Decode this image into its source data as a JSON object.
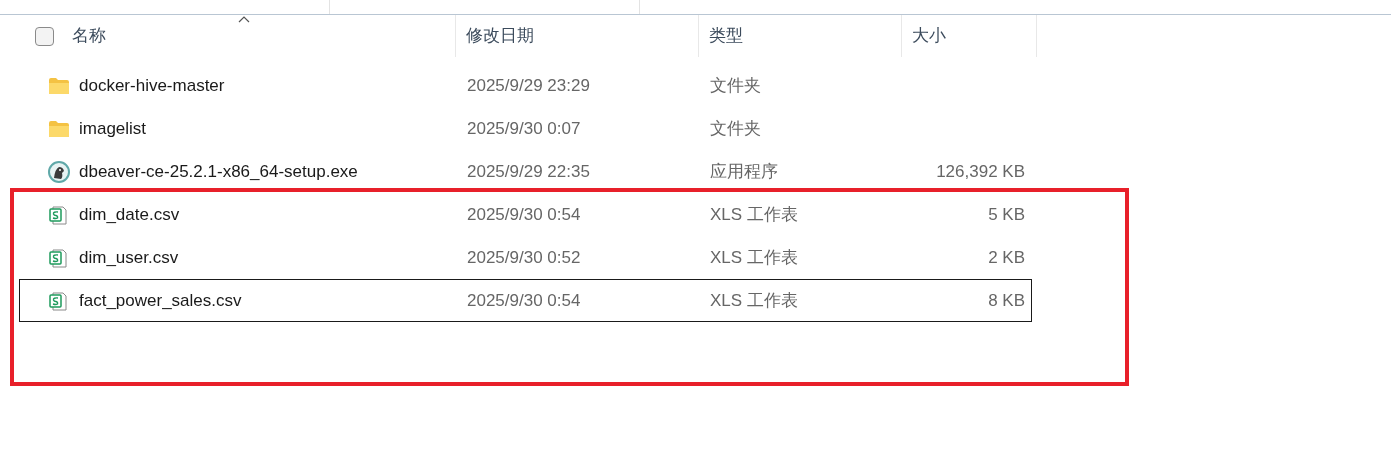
{
  "columns": [
    {
      "label": "名称",
      "sorted": true
    },
    {
      "label": "修改日期",
      "sorted": false
    },
    {
      "label": "类型",
      "sorted": false
    },
    {
      "label": "大小",
      "sorted": false
    }
  ],
  "select_all": {
    "checked": false
  },
  "rows": [
    {
      "kind": "folder",
      "name": "docker-hive-master",
      "modified": "2025/9/29 23:29",
      "type": "文件夹",
      "focused": false
    },
    {
      "kind": "folder",
      "name": "imagelist",
      "modified": "2025/9/30 0:07",
      "type": "文件夹",
      "focused": false
    },
    {
      "kind": "app",
      "name": "dbeaver-ce-25.2.1-x86_64-setup.exe",
      "modified": "2025/9/29 22:35",
      "type": "应用程序",
      "size": "126,392 KB",
      "focused": false
    },
    {
      "kind": "sheet",
      "name": "dim_date.csv",
      "modified": "2025/9/30 0:54",
      "type": "XLS 工作表",
      "size": "5 KB",
      "focused": false
    },
    {
      "kind": "sheet",
      "name": "dim_user.csv",
      "modified": "2025/9/30 0:52",
      "type": "XLS 工作表",
      "size": "2 KB",
      "focused": false
    },
    {
      "kind": "sheet",
      "name": "fact_power_sales.csv",
      "modified": "2025/9/30 0:54",
      "type": "XLS 工作表",
      "size": "8 KB",
      "focused": true
    }
  ],
  "highlight": {
    "color": "#e8202a"
  }
}
